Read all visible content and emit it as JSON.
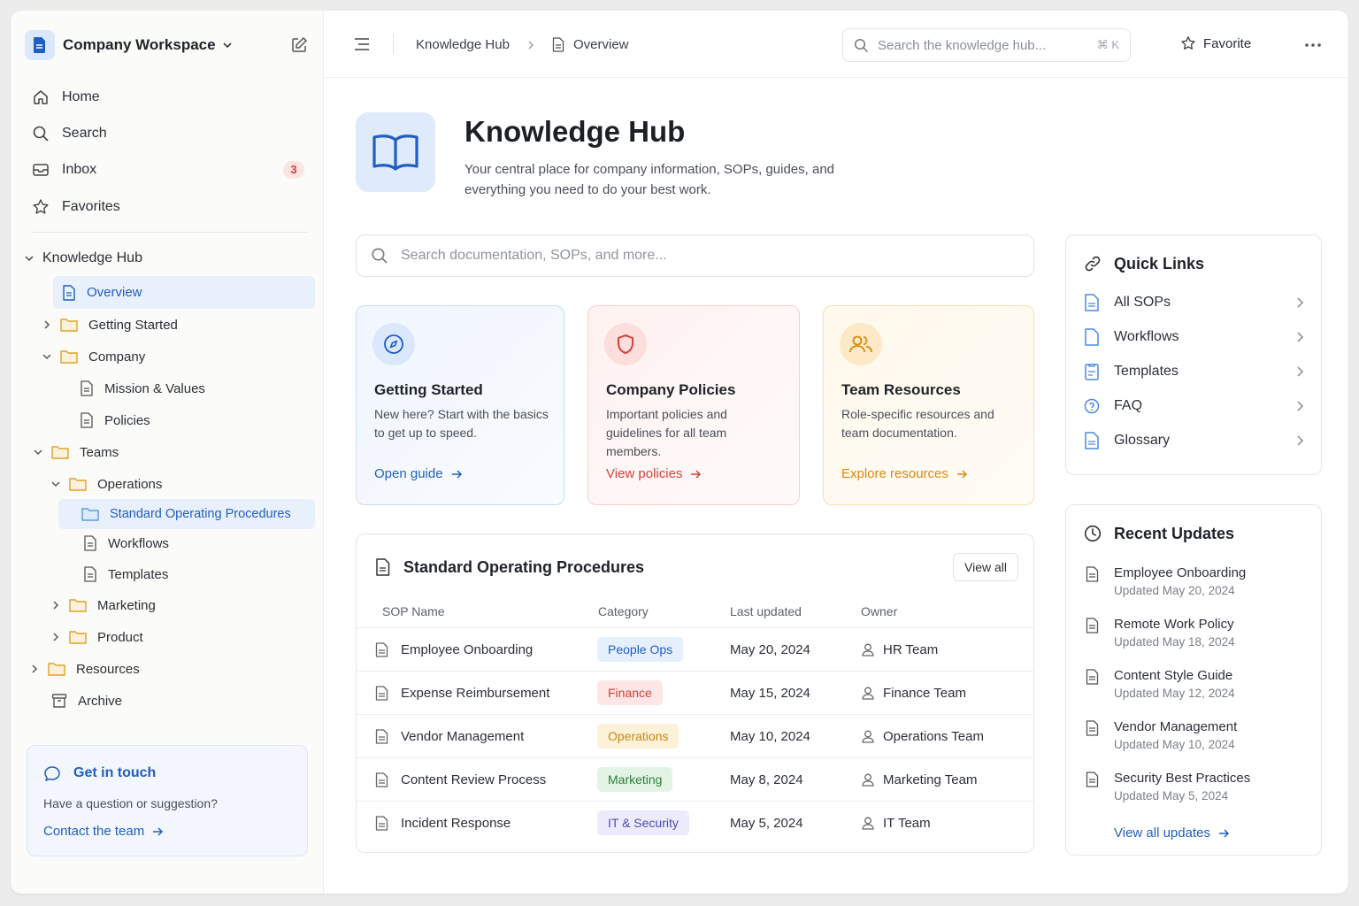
{
  "sidebar": {
    "workspace": "Company Workspace",
    "nav": [
      {
        "label": "Home",
        "icon": "home-icon"
      },
      {
        "label": "Search",
        "icon": "search-icon"
      },
      {
        "label": "Inbox",
        "icon": "inbox-icon",
        "badge": "3"
      },
      {
        "label": "Favorites",
        "icon": "star-icon"
      }
    ],
    "tree": {
      "knowledge_hub": "Knowledge Hub",
      "overview": "Overview",
      "getting_started": "Getting Started",
      "company": "Company",
      "mission": "Mission & Values",
      "policies": "Policies",
      "teams": "Teams",
      "operations": "Operations",
      "sop": "Standard Operating Procedures",
      "workflows": "Workflows",
      "templates": "Templates",
      "marketing": "Marketing",
      "product": "Product",
      "resources": "Resources",
      "archive": "Archive"
    },
    "contact": {
      "title": "Get in touch",
      "text": "Have a question or suggestion?",
      "link": "Contact the team"
    }
  },
  "topbar": {
    "breadcrumb": [
      "Knowledge Hub",
      "Overview"
    ],
    "search_placeholder": "Search the knowledge hub...",
    "shortcut": "⌘ K",
    "favorite": "Favorite"
  },
  "hero": {
    "title": "Knowledge Hub",
    "subtitle": "Your central place for company information, SOPs, guides, and everything you need to do your best work."
  },
  "main_search_placeholder": "Search documentation, SOPs, and more...",
  "cards": [
    {
      "title": "Getting Started",
      "desc": "New here? Start with the basics to get up to speed.",
      "link": "Open guide",
      "color": "#1f5fbf"
    },
    {
      "title": "Company Policies",
      "desc": "Important policies and guidelines for all team members.",
      "link": "View policies",
      "color": "#d2413a"
    },
    {
      "title": "Team Resources",
      "desc": "Role-specific resources and team documentation.",
      "link": "Explore resources",
      "color": "#d98a0b"
    }
  ],
  "sop": {
    "title": "Standard Operating Procedures",
    "view_all": "View all",
    "columns": [
      "SOP Name",
      "Category",
      "Last updated",
      "Owner"
    ],
    "rows": [
      {
        "name": "Employee Onboarding",
        "category": "People Ops",
        "updated": "May 20, 2024",
        "owner": "HR Team"
      },
      {
        "name": "Expense Reimbursement",
        "category": "Finance",
        "updated": "May 15, 2024",
        "owner": "Finance Team"
      },
      {
        "name": "Vendor Management",
        "category": "Operations",
        "updated": "May 10, 2024",
        "owner": "Operations Team"
      },
      {
        "name": "Content Review Process",
        "category": "Marketing",
        "updated": "May 8, 2024",
        "owner": "Marketing Team"
      },
      {
        "name": "Incident Response",
        "category": "IT & Security",
        "updated": "May 5, 2024",
        "owner": "IT Team"
      }
    ]
  },
  "quick_links": {
    "title": "Quick Links",
    "items": [
      "All SOPs",
      "Workflows",
      "Templates",
      "FAQ",
      "Glossary"
    ]
  },
  "recent": {
    "title": "Recent Updates",
    "items": [
      {
        "name": "Employee Onboarding",
        "date": "Updated May 20, 2024"
      },
      {
        "name": "Remote Work Policy",
        "date": "Updated May 18, 2024"
      },
      {
        "name": "Content Style Guide",
        "date": "Updated May 12, 2024"
      },
      {
        "name": "Vendor Management",
        "date": "Updated May 10, 2024"
      },
      {
        "name": "Security Best Practices",
        "date": "Updated May 5, 2024"
      }
    ],
    "view_all": "View all updates"
  }
}
